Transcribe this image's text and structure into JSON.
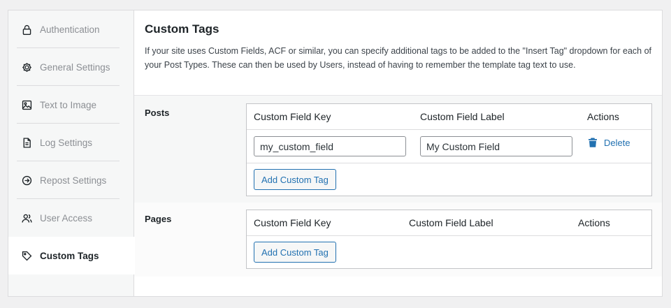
{
  "sidebar": {
    "items": [
      {
        "label": "Authentication",
        "icon": "lock-icon"
      },
      {
        "label": "General Settings",
        "icon": "gear-icon"
      },
      {
        "label": "Text to Image",
        "icon": "image-icon"
      },
      {
        "label": "Log Settings",
        "icon": "document-icon"
      },
      {
        "label": "Repost Settings",
        "icon": "circle-arrow-icon"
      },
      {
        "label": "User Access",
        "icon": "users-icon"
      },
      {
        "label": "Custom Tags",
        "icon": "tag-icon",
        "active": true
      }
    ]
  },
  "main": {
    "title": "Custom Tags",
    "description": "If your site uses Custom Fields, ACF or similar, you can specify additional tags to be added to the \"Insert Tag\" dropdown for each of your Post Types. These can then be used by Users, instead of having to remember the template tag text to use.",
    "sections": [
      {
        "label": "Posts",
        "columns": [
          "Custom Field Key",
          "Custom Field Label",
          "Actions"
        ],
        "rows": [
          {
            "key": "my_custom_field",
            "label": "My Custom Field",
            "action": "Delete"
          }
        ],
        "add_button": "Add Custom Tag"
      },
      {
        "label": "Pages",
        "columns": [
          "Custom Field Key",
          "Custom Field Label",
          "Actions"
        ],
        "rows": [],
        "add_button": "Add Custom Tag"
      }
    ]
  },
  "colors": {
    "accent": "#2271b1",
    "background": "#f0f0f1",
    "sidebar": "#f6f7f7",
    "muted_text": "#8c8f94"
  }
}
